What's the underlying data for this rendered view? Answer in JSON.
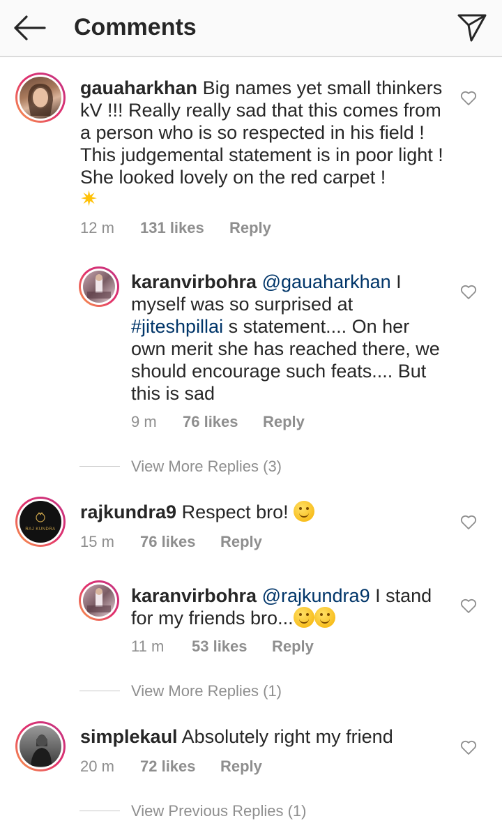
{
  "header": {
    "title": "Comments"
  },
  "comments": [
    {
      "user": "gauaharkhan",
      "text": "Big names yet small thinkers kV !!! Really really sad that this comes from a person who is so respected in his field ! This judgemental statement is in poor light ! She looked lovely on the red carpet !",
      "time": "12 m",
      "likes": "131 likes",
      "reply": "Reply"
    },
    {
      "user": "karanvirbohra",
      "mention": "@gauaharkhan",
      "text_a": "I myself was so surprised at",
      "hashtag": "#jiteshpillai",
      "text_b": " s statement.... On her own merit she has reached there, we should encourage such feats.... But this is sad",
      "time": "9 m",
      "likes": "76 likes",
      "reply": "Reply"
    },
    {
      "user": "rajkundra9",
      "text": "Respect bro!",
      "avatar_logo": "RAJ KUNDRA",
      "time": "15 m",
      "likes": "76 likes",
      "reply": "Reply"
    },
    {
      "user": "karanvirbohra",
      "mention": "@rajkundra9",
      "text": "I stand for my friends bro...",
      "time": "11 m",
      "likes": "53 likes",
      "reply": "Reply"
    },
    {
      "user": "simplekaul",
      "text": "Absolutely right my friend",
      "time": "20 m",
      "likes": "72 likes",
      "reply": "Reply"
    }
  ],
  "more_replies": [
    "View More Replies (3)",
    "View More Replies (1)",
    "View Previous Replies (1)"
  ],
  "icons": [
    "back-arrow-icon",
    "send-icon",
    "heart-icon",
    "hugging-face-emoji",
    "sparkle-emoji"
  ]
}
